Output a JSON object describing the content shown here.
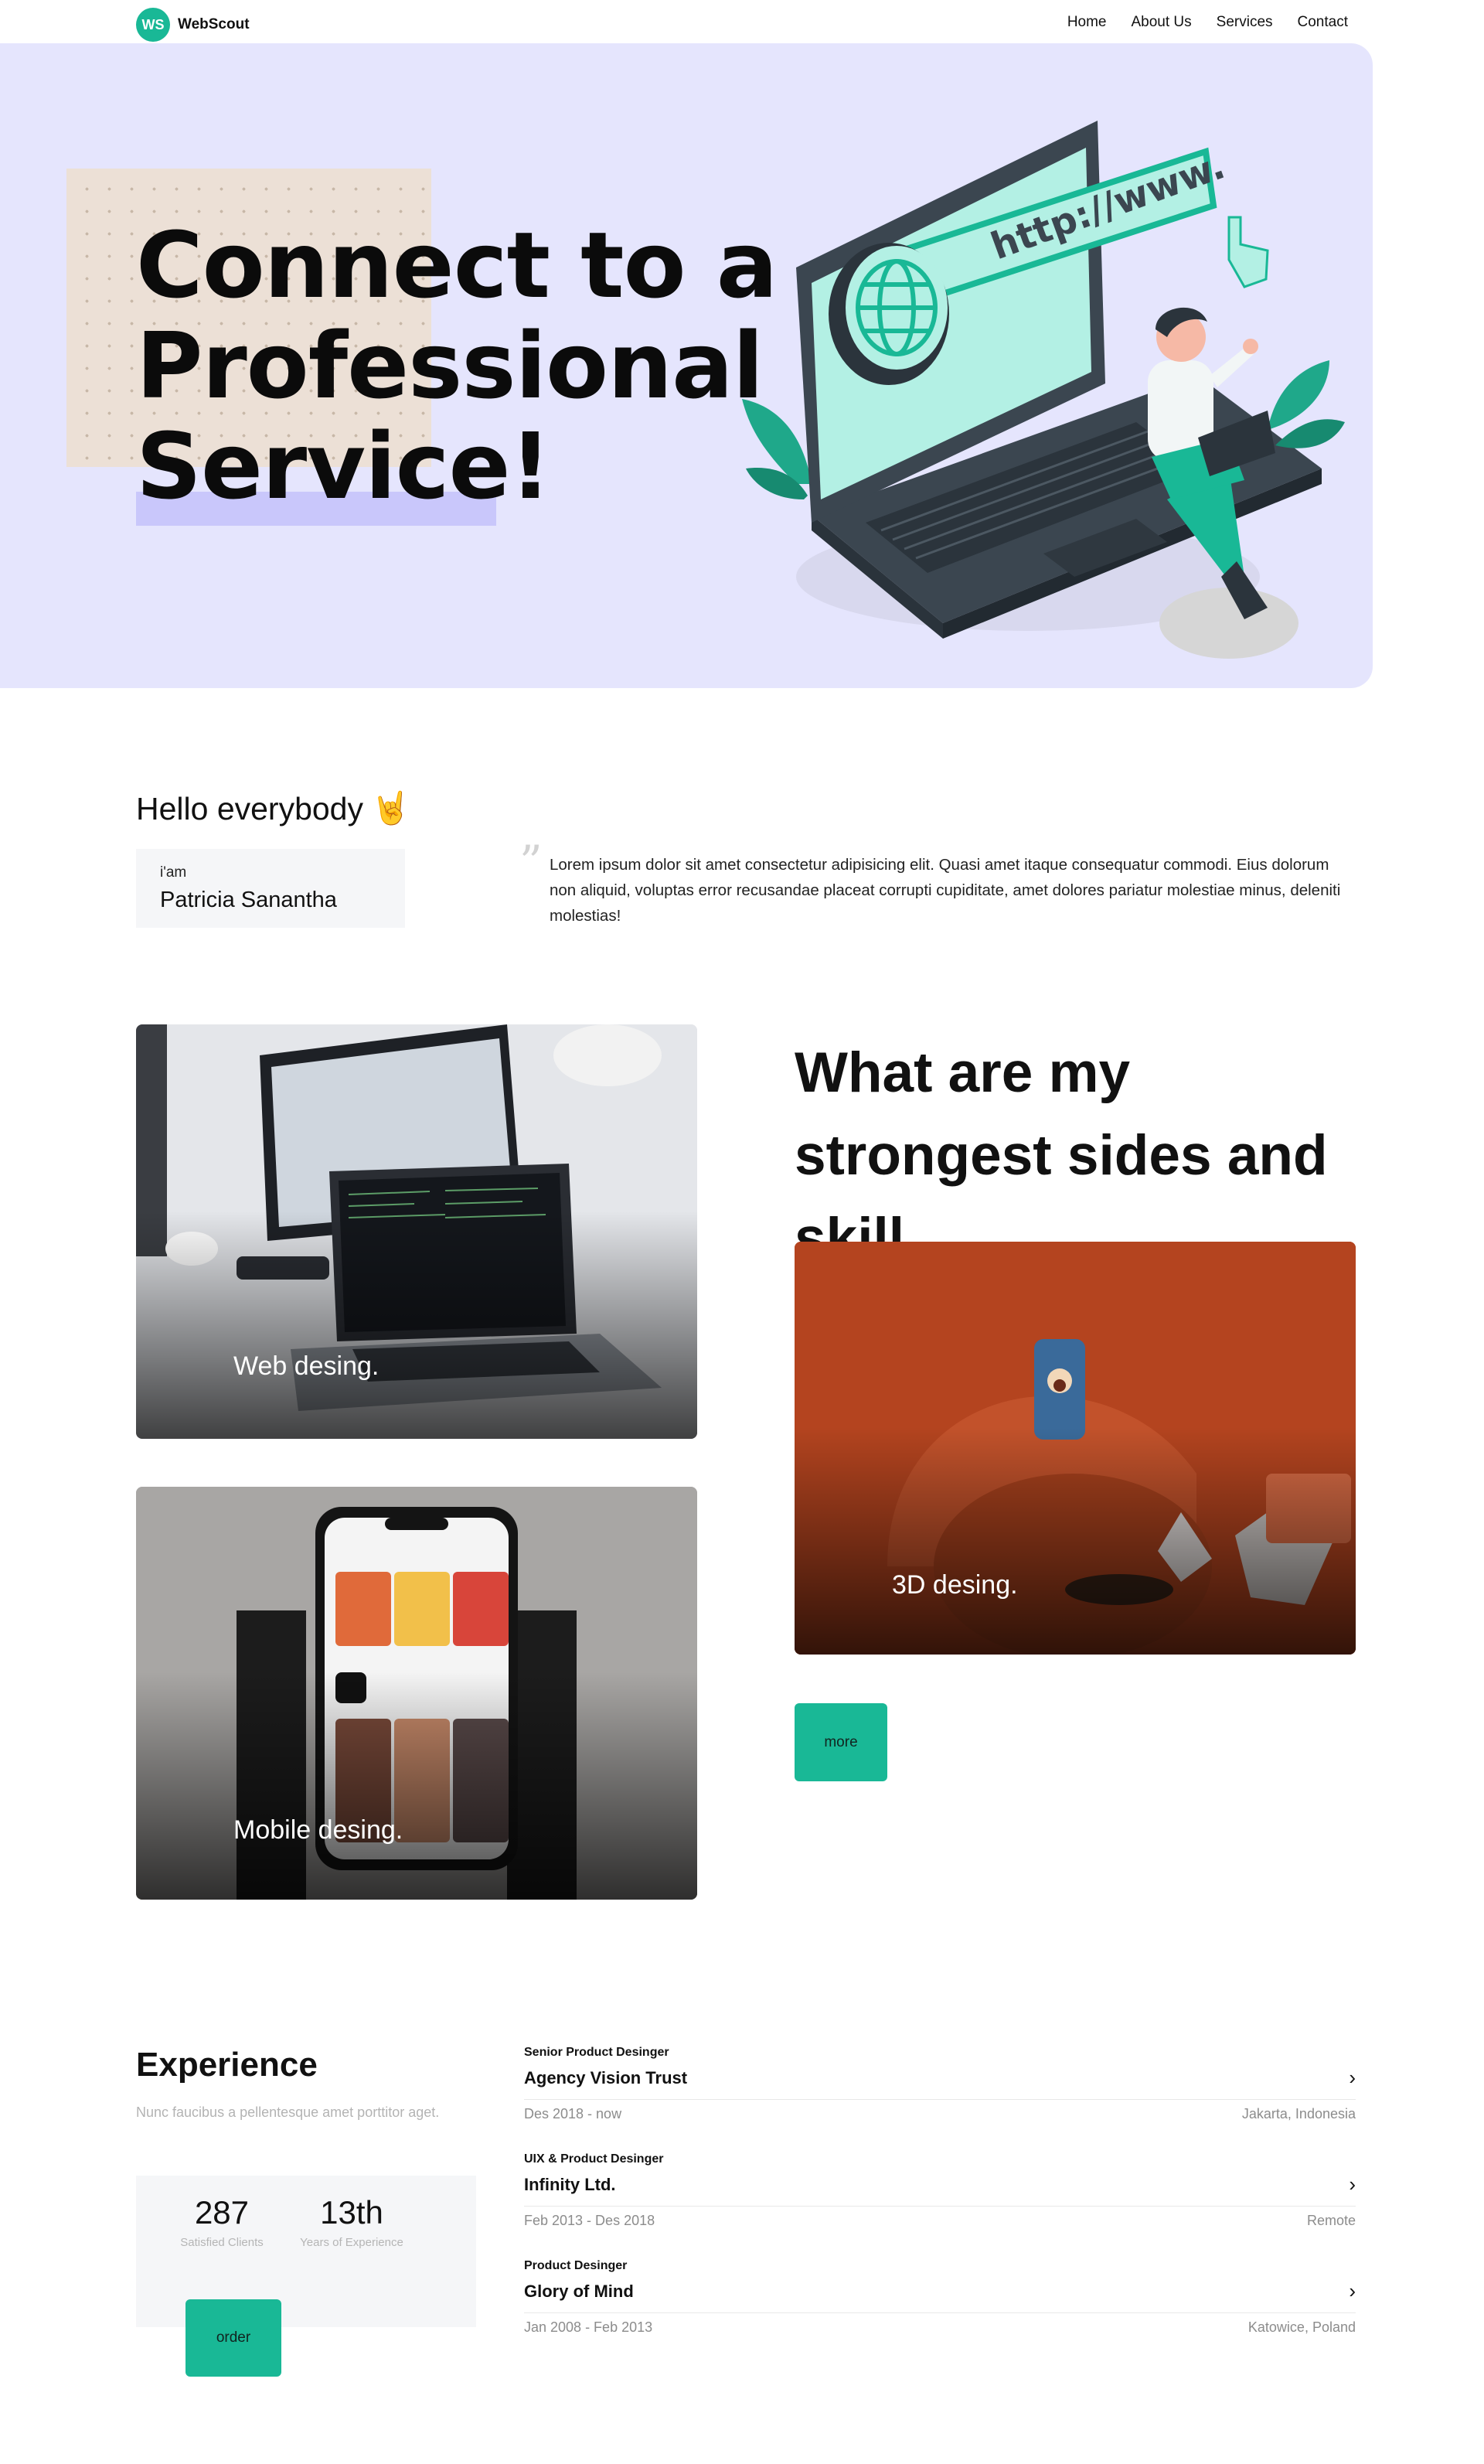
{
  "brand": {
    "logo_initials": "WS",
    "name": "WebScout",
    "accent_color": "#19b896"
  },
  "nav": {
    "items": [
      "Home",
      "About Us",
      "Services",
      "Contact"
    ]
  },
  "hero": {
    "title_lines": [
      "Connect to a",
      "Professional",
      "Service!"
    ],
    "background_color": "#e5e5fd",
    "illustration_text": "http://www."
  },
  "intro": {
    "greeting": "Hello everybody",
    "greeting_emoji": "🤘",
    "iam_label": "i'am",
    "name": "Patricia Sanantha",
    "quote_mark": "”",
    "text": "Lorem ipsum dolor sit amet consectetur adipisicing elit. Quasi amet itaque consequatur commodi. Eius dolorum non aliquid, voluptas error recusandae placeat corrupti cupiditate, amet dolores pariatur molestiae minus, deleniti molestias!"
  },
  "skills": {
    "heading": "What are my strongest sides and skill",
    "cards": [
      {
        "label": "Web desing."
      },
      {
        "label": "Mobile desing."
      },
      {
        "label": "3D desing."
      }
    ],
    "more_button": "more"
  },
  "experience": {
    "heading": "Experience",
    "subtitle": "Nunc faucibus a pellentesque amet porttitor aget.",
    "stats": [
      {
        "value": "287",
        "label": "Satisfied Clients"
      },
      {
        "value": "13th",
        "label": "Years of Experience"
      }
    ],
    "order_button": "order",
    "jobs": [
      {
        "role": "Senior Product Desinger",
        "company": "Agency Vision Trust",
        "period": "Des 2018 - now",
        "location": "Jakarta, Indonesia"
      },
      {
        "role": "UIX & Product Desinger",
        "company": "Infinity Ltd.",
        "period": "Feb 2013 - Des 2018",
        "location": "Remote"
      },
      {
        "role": "Product Desinger",
        "company": "Glory of Mind",
        "period": "Jan 2008 - Feb 2013",
        "location": "Katowice, Poland"
      }
    ],
    "chevron_icon": "chevron-right-icon"
  }
}
